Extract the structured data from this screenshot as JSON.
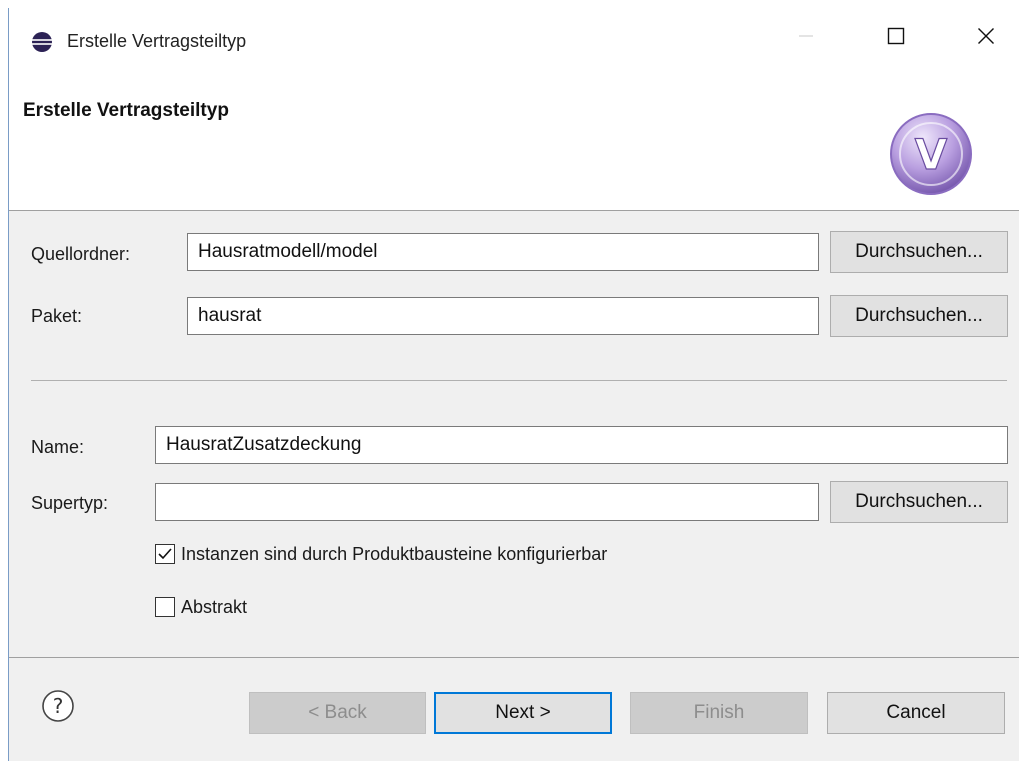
{
  "window": {
    "title": "Erstelle Vertragsteiltyp",
    "controls": {
      "minimize": "—",
      "maximize": "☐",
      "close": "✕"
    }
  },
  "header": {
    "title": "Erstelle Vertragsteiltyp",
    "logo_letter": "V"
  },
  "form": {
    "source_folder": {
      "label": "Quellordner:",
      "value": "Hausratmodell/model",
      "browse": "Durchsuchen..."
    },
    "package": {
      "label": "Paket:",
      "value": "hausrat",
      "browse": "Durchsuchen..."
    },
    "name": {
      "label": "Name:",
      "value": "HausratZusatzdeckung"
    },
    "supertype": {
      "label": "Supertyp:",
      "value": "",
      "browse": "Durchsuchen..."
    },
    "configurable": {
      "label": "Instanzen sind durch Produktbausteine konfigurierbar",
      "checked": true
    },
    "abstract": {
      "label": "Abstrakt",
      "checked": false
    }
  },
  "buttons": {
    "back": "< Back",
    "next": "Next >",
    "finish": "Finish",
    "cancel": "Cancel"
  },
  "icons": {
    "app": "eclipse-icon",
    "help": "help-icon",
    "logo": "vertragsteil-logo-icon"
  },
  "colors": {
    "accent": "#0078d7",
    "logo": "#9b7fc9"
  }
}
